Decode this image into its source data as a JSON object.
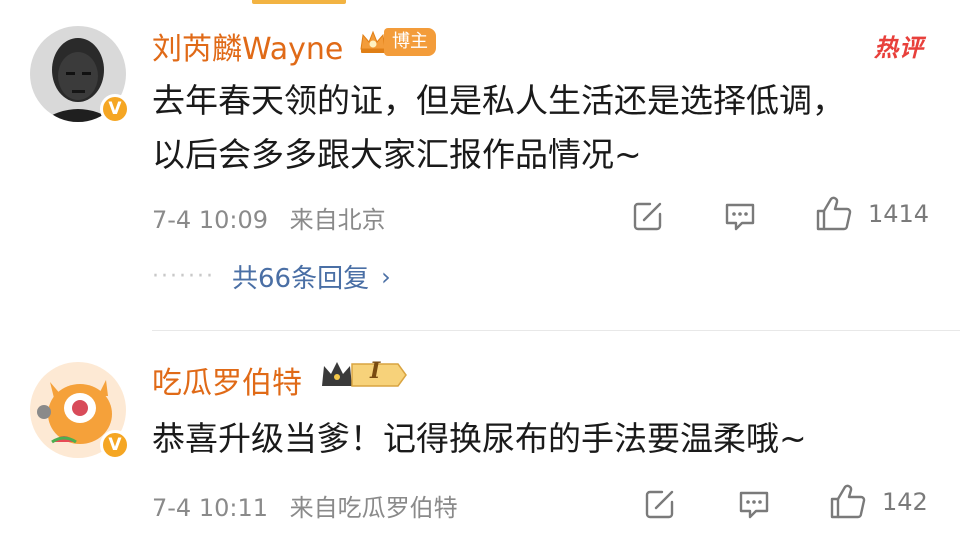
{
  "comments": [
    {
      "username": "刘芮麟Wayne",
      "badge": "博主",
      "hot_tag": "热评",
      "text_lines": [
        "去年春天领的证，但是私人生活还是选择低调，",
        "以后会多多跟大家汇报作品情况~"
      ],
      "time": "7-4 10:09",
      "location": "来自北京",
      "likes": "1414",
      "replies_link": "共66条回复",
      "replies_dots": "·······",
      "replies_chevron": "›"
    },
    {
      "username": "吃瓜罗伯特",
      "level_badge": "I",
      "text_lines": [
        "恭喜升级当爹！记得换尿布的手法要温柔哦~"
      ],
      "time": "7-4 10:11",
      "location": "来自吃瓜罗伯特",
      "likes": "142"
    }
  ],
  "verified_mark": "V",
  "colors": {
    "username": "#e06a17",
    "meta": "#8a8a8a",
    "link": "#4a6fa5",
    "hot": "#e8403b",
    "badge": "#f39c3a",
    "verified": "#f5a623"
  },
  "icons": {
    "repost": "edit-square-icon",
    "comment": "comment-bubble-icon",
    "like": "thumbs-up-icon",
    "badge_crown": "crown-icon",
    "verified": "verified-v-icon"
  }
}
